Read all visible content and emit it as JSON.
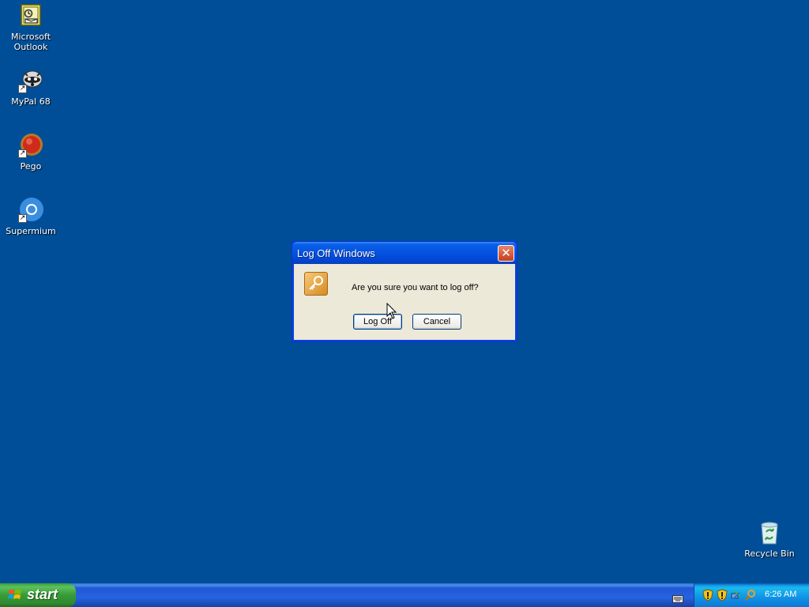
{
  "desktop": {
    "icons": [
      {
        "label": "Microsoft Outlook",
        "icon": "outlook-icon"
      },
      {
        "label": "MyPal 68",
        "icon": "mypal-icon"
      },
      {
        "label": "Pego",
        "icon": "pego-icon"
      },
      {
        "label": "Supermium",
        "icon": "supermium-icon"
      },
      {
        "label": "Recycle Bin",
        "icon": "recycle-bin-icon"
      }
    ]
  },
  "dialog": {
    "title": "Log Off Windows",
    "close_symbol": "✕",
    "message": "Are you sure you want to log off?",
    "logoff_label": "Log Off",
    "cancel_label": "Cancel"
  },
  "taskbar": {
    "start_label": "start",
    "clock": "6:26 AM",
    "tray_icons": [
      "shield-icon",
      "shield-icon",
      "network-icon",
      "search-icon"
    ]
  },
  "colors": {
    "desktop_bg": "#004e98",
    "title_blue": "#0553e1",
    "close_red": "#c4401f",
    "start_green": "#379b37",
    "tray_blue": "#1093e6"
  }
}
